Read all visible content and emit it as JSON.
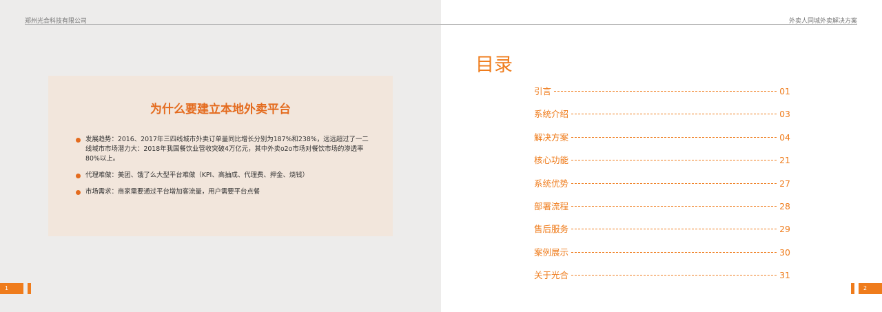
{
  "header": {
    "company": "郑州光合科技有限公司",
    "doc_title": "外卖人同城外卖解决方案"
  },
  "left": {
    "card_title": "为什么要建立本地外卖平台",
    "bullets": [
      "发展趋势：2016、2017年三四线城市外卖订单量同比增长分别为187%和238%，远远超过了一二线城市市场潜力大：2018年我国餐饮业营收突破4万亿元，其中外卖o2o市场对餐饮市场的渗透率80%以上。",
      "代理难做：美团、饿了么大型平台难做（KPI、高抽成、代理费、押金、烧钱）",
      "市场需求：商家需要通过平台增加客流量，用户需要平台点餐"
    ],
    "page_number": "1"
  },
  "right": {
    "toc_title": "目录",
    "toc": [
      {
        "label": "引言",
        "page": "01"
      },
      {
        "label": "系统介绍",
        "page": "03"
      },
      {
        "label": "解决方案",
        "page": "04"
      },
      {
        "label": "核心功能",
        "page": "21"
      },
      {
        "label": "系统优势",
        "page": "27"
      },
      {
        "label": "部署流程",
        "page": "28"
      },
      {
        "label": "售后服务",
        "page": "29"
      },
      {
        "label": "案例展示",
        "page": "30"
      },
      {
        "label": "关于光合",
        "page": "31"
      }
    ],
    "page_number": "2"
  },
  "colors": {
    "accent": "#ef7c1c",
    "card_bg": "#f2e6dc",
    "left_bg": "#edeceb"
  }
}
